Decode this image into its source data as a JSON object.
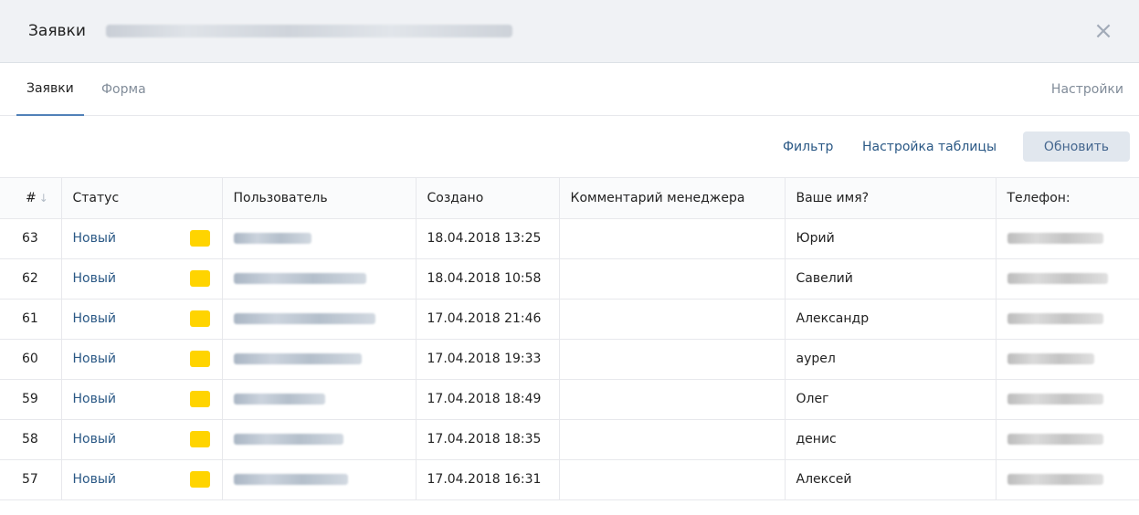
{
  "header": {
    "title": "Заявки",
    "close_icon": "close-icon"
  },
  "tabs": {
    "items": [
      {
        "label": "Заявки",
        "active": true
      },
      {
        "label": "Форма",
        "active": false
      }
    ],
    "settings_label": "Настройки"
  },
  "toolbar": {
    "filter_label": "Фильтр",
    "table_settings_label": "Настройка таблицы",
    "refresh_label": "Обновить"
  },
  "table": {
    "columns": [
      "#",
      "Статус",
      "Пользователь",
      "Создано",
      "Комментарий менеджера",
      "Ваше имя?",
      "Телефон:"
    ],
    "sort_icon": "sort-down-icon",
    "rows": [
      {
        "num": "63",
        "status": "Новый",
        "created": "18.04.2018 13:25",
        "comment": "",
        "name": "Юрий"
      },
      {
        "num": "62",
        "status": "Новый",
        "created": "18.04.2018 10:58",
        "comment": "",
        "name": "Савелий"
      },
      {
        "num": "61",
        "status": "Новый",
        "created": "17.04.2018 21:46",
        "comment": "",
        "name": "Александр"
      },
      {
        "num": "60",
        "status": "Новый",
        "created": "17.04.2018 19:33",
        "comment": "",
        "name": "аурел"
      },
      {
        "num": "59",
        "status": "Новый",
        "created": "17.04.2018 18:49",
        "comment": "",
        "name": "Олег"
      },
      {
        "num": "58",
        "status": "Новый",
        "created": "17.04.2018 18:35",
        "comment": "",
        "name": "денис"
      },
      {
        "num": "57",
        "status": "Новый",
        "created": "17.04.2018 16:31",
        "comment": "",
        "name": "Алексей"
      }
    ]
  },
  "colors": {
    "accent": "#5181b8",
    "link": "#2a5885",
    "status_tag": "#ffd400",
    "header_bg": "#f0f2f5"
  }
}
